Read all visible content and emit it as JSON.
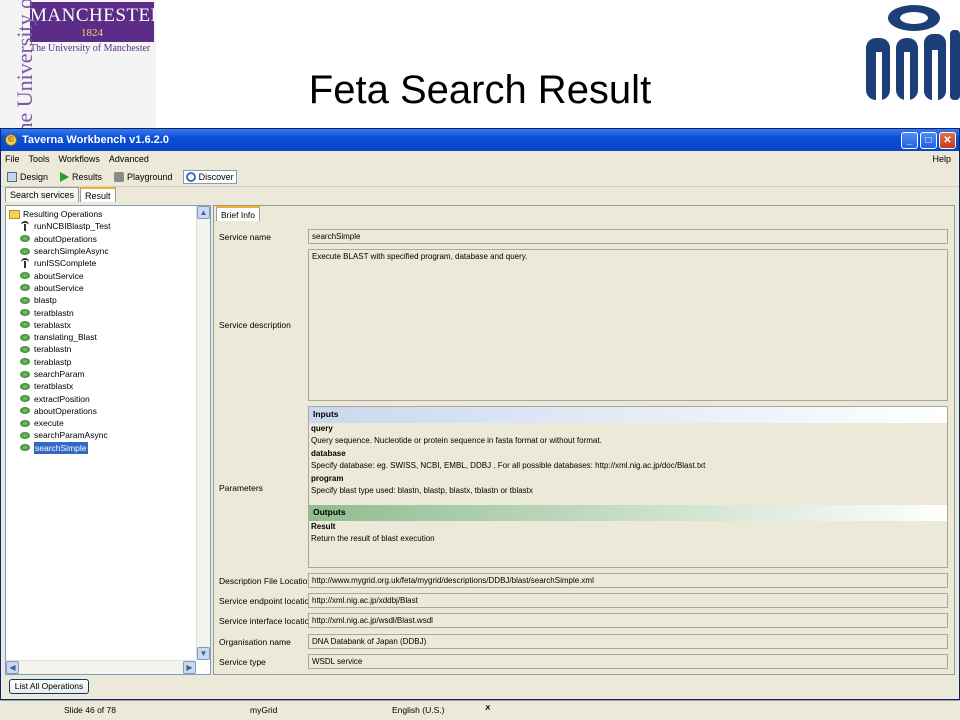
{
  "slide": {
    "title": "Feta Search Result",
    "logo_manchester": "MANCHESTER",
    "logo_year": "1824",
    "logo_subtitle": "The University of Manchester",
    "logo_vertical": "The University of Manchester"
  },
  "window": {
    "title": "Taverna Workbench v1.6.2.0"
  },
  "menu": {
    "items": [
      "File",
      "Tools",
      "Workflows",
      "Advanced"
    ],
    "help": "Help"
  },
  "toolbar": {
    "design": "Design",
    "results": "Results",
    "playground": "Playground",
    "discover": "Discover"
  },
  "tabs": {
    "search": "Search services",
    "result": "Result"
  },
  "tree": {
    "root": "Resulting Operations",
    "items": [
      "runNCBIBlastp_Test",
      "aboutOperations",
      "searchSimpleAsync",
      "runISSComplete",
      "aboutService",
      "aboutService",
      "blastp",
      "teratblastn",
      "terablastx",
      "translating_Blast",
      "terablastn",
      "terablastp",
      "searchParam",
      "teratblastx",
      "extractPosition",
      "aboutOperations",
      "execute",
      "searchParamAsync",
      "searchSimple"
    ]
  },
  "list_all_button": "List All Operations",
  "detail": {
    "tab": "Brief Info",
    "labels": {
      "service_name": "Service name",
      "service_description": "Service description",
      "parameters": "Parameters",
      "description_file": "Description File Location",
      "endpoint": "Service endpoint location",
      "interface": "Service interface location",
      "organisation": "Organisation name",
      "service_type": "Service type"
    },
    "values": {
      "service_name": "searchSimple",
      "service_description": "Execute BLAST with specified program, database and query.",
      "description_file": "http://www.mygrid.org.uk/feta/mygrid/descriptions/DDBJ/blast/searchSimple.xml",
      "endpoint": "http://xml.nig.ac.jp/xddbj/Blast",
      "interface": "http://xml.nig.ac.jp/wsdl/Blast.wsdl",
      "organisation": "DNA Databank of Japan (DDBJ)",
      "service_type": "WSDL service"
    },
    "params": {
      "inputs_header": "Inputs",
      "outputs_header": "Outputs",
      "inputs": [
        {
          "name": "query",
          "desc": "Query sequence. Nucleotide or protein sequence in fasta format or without format."
        },
        {
          "name": "database",
          "desc": "Specify database: eg. SWISS, NCBI, EMBL, DDBJ . For all possible databases:  http://xml.nig.ac.jp/doc/Blast.txt"
        },
        {
          "name": "program",
          "desc": "Specify blast type used: blastn, blastp, blastx, tblastn or tblastx"
        }
      ],
      "outputs": [
        {
          "name": "Result",
          "desc": "Return the result of blast execution"
        }
      ]
    }
  },
  "status": {
    "slide": "Slide 46 of 78",
    "template": "myGrid",
    "language": "English (U.S.)"
  }
}
